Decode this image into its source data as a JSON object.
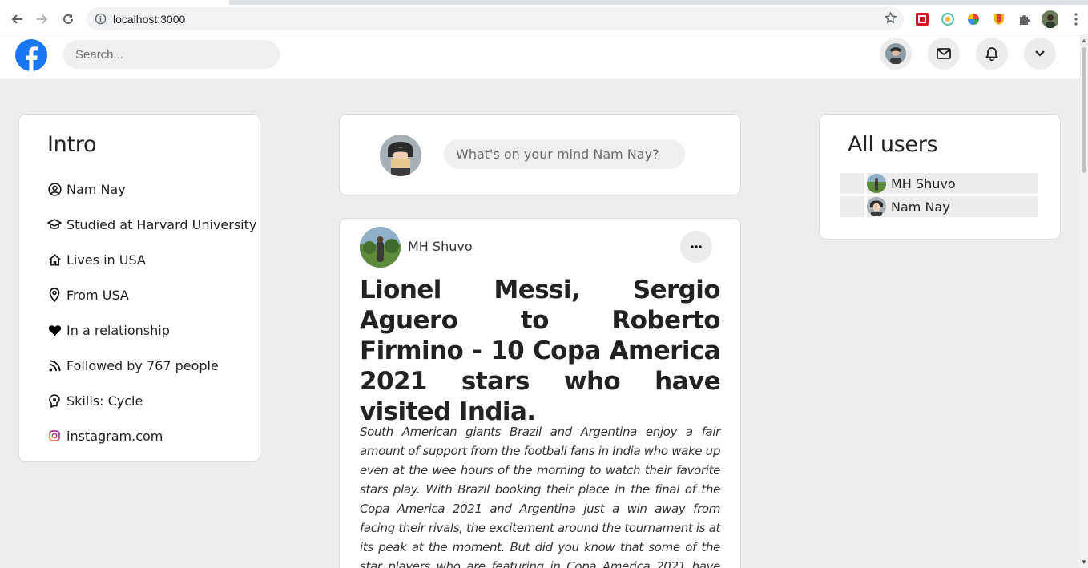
{
  "browser": {
    "url": "localhost:3000"
  },
  "header": {
    "search_placeholder": "Search..."
  },
  "intro": {
    "title": "Intro",
    "items": [
      {
        "icon": "user-circle-icon",
        "label": "Nam Nay"
      },
      {
        "icon": "graduation-cap-icon",
        "label": "Studied at Harvard University"
      },
      {
        "icon": "home-icon",
        "label": "Lives in USA"
      },
      {
        "icon": "location-pin-icon",
        "label": "From USA"
      },
      {
        "icon": "heart-icon",
        "label": "In a relationship"
      },
      {
        "icon": "rss-icon",
        "label": "Followed by 767 people"
      },
      {
        "icon": "skills-icon",
        "label": "Skills: Cycle"
      },
      {
        "icon": "instagram-icon",
        "label": "instagram.com"
      }
    ]
  },
  "composer": {
    "placeholder": "What's on your mind Nam Nay?"
  },
  "post": {
    "author": "MH Shuvo",
    "title": "Lionel Messi, Sergio Aguero to Roberto Firmino - 10 Copa America 2021 stars who have visited India.",
    "body": "South American giants Brazil and Argentina enjoy a fair amount of support from the football fans in India who wake up even at the wee hours of the morning to watch their favorite stars play. With Brazil booking their place in the final of the Copa America 2021 and Argentina just a win away from facing their rivals, the excitement around the tournament is at its peak at the moment. But did you know that some of the star players who are featuring in Copa America 2021 have visited India in the past and played"
  },
  "users": {
    "title": "All users",
    "list": [
      {
        "name": "MH Shuvo"
      },
      {
        "name": "Nam Nay"
      }
    ]
  },
  "colors": {
    "brand": "#1877f2",
    "page_background": "#ededed",
    "card_background": "#ffffff"
  }
}
